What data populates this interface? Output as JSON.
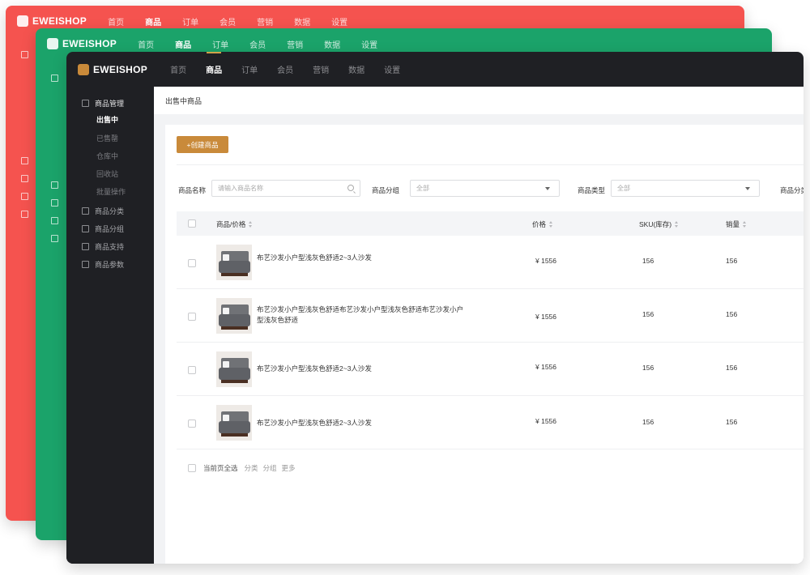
{
  "brand": {
    "name": "EWEISHOP"
  },
  "nav": [
    "首页",
    "商品",
    "订单",
    "会员",
    "营销",
    "数据",
    "设置"
  ],
  "nav_active_index": 1,
  "sidebar": {
    "group_title": "商品管理",
    "sub_items": [
      "出售中",
      "已售罄",
      "仓库中",
      "回收站",
      "批量操作"
    ],
    "active_sub_index": 0,
    "other_groups": [
      "商品分类",
      "商品分组",
      "商品支持",
      "商品参数"
    ]
  },
  "breadcrumb": "出售中商品",
  "create_button": "+创建商品",
  "filters": {
    "name_label": "商品名称",
    "name_placeholder": "请输入商品名称",
    "group_label": "商品分组",
    "group_value": "全部",
    "type_label": "商品类型",
    "type_value": "全部",
    "extra_label": "商品分类"
  },
  "table": {
    "headers": {
      "product": "商品/价格",
      "price": "价格",
      "sku": "SKU(库存)",
      "sales": "销量"
    },
    "rows": [
      {
        "name": "布艺沙发小户型浅灰色舒适2~3人沙发",
        "price": "¥ 1556",
        "sku": "156",
        "sales": "156"
      },
      {
        "name": "布艺沙发小户型浅灰色舒适布艺沙发小户型浅灰色舒适布艺沙发小户型浅灰色舒适",
        "price": "¥ 1556",
        "sku": "156",
        "sales": "156"
      },
      {
        "name": "布艺沙发小户型浅灰色舒适2~3人沙发",
        "price": "¥ 1556",
        "sku": "156",
        "sales": "156"
      },
      {
        "name": "布艺沙发小户型浅灰色舒适2~3人沙发",
        "price": "¥ 1556",
        "sku": "156",
        "sales": "156"
      }
    ]
  },
  "footer": {
    "select_all": "当前页全选",
    "links": [
      "分类",
      "分组",
      "更多"
    ]
  },
  "colors": {
    "red_theme": "#f5534f",
    "green_theme": "#1ba36a",
    "dark_theme": "#1f2024",
    "accent": "#c98a3a"
  }
}
